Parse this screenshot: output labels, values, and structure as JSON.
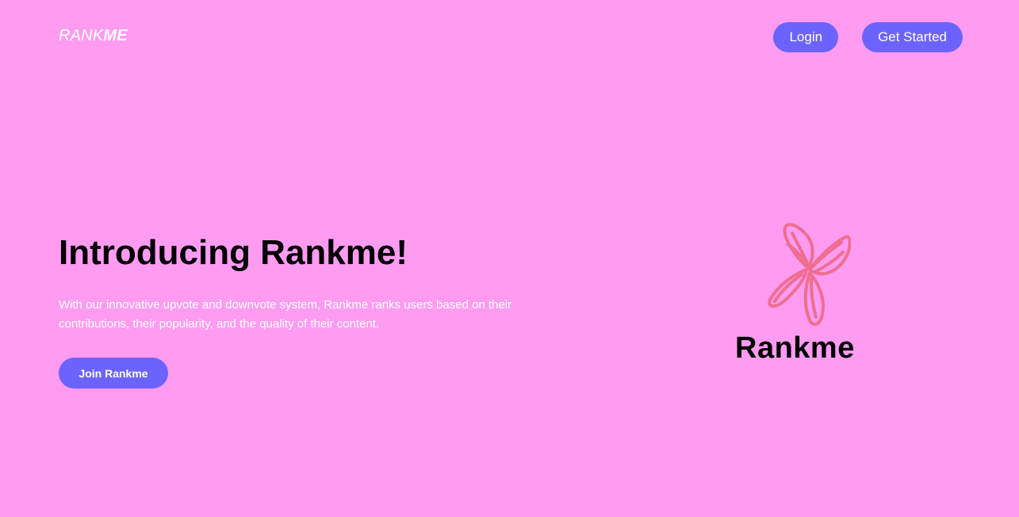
{
  "header": {
    "brand_regular": "RANK",
    "brand_bold": "ME",
    "login_label": "Login",
    "get_started_label": "Get Started"
  },
  "hero": {
    "title": "Introducing Rankme!",
    "description": "With our innovative upvote and downvote system, Rankme ranks users based on their contributions, their popularity, and the quality of their content.",
    "cta_label": "Join Rankme"
  },
  "logo": {
    "wordmark": "Rankme",
    "icon": "butterfly-icon",
    "icon_color": "#ef6e91"
  },
  "colors": {
    "background": "#ff9cf2",
    "accent": "#6c63ff",
    "text_light": "#ffffff",
    "text_dark": "#000000"
  }
}
